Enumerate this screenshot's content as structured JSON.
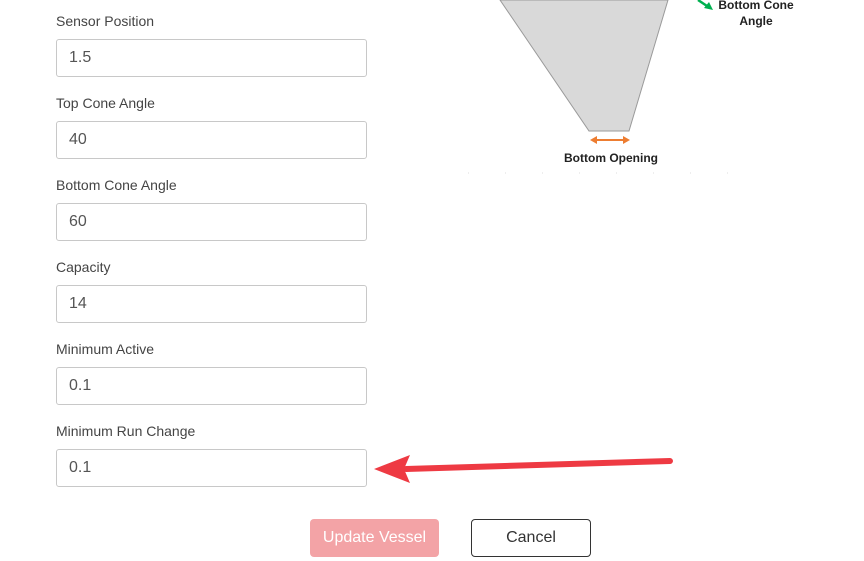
{
  "form": {
    "fields": [
      {
        "label": "Sensor Position",
        "value": "1.5"
      },
      {
        "label": "Top Cone Angle",
        "value": "40"
      },
      {
        "label": "Bottom Cone Angle",
        "value": "60"
      },
      {
        "label": "Capacity",
        "value": "14"
      },
      {
        "label": "Minimum Active",
        "value": "0.1"
      },
      {
        "label": "Minimum Run Change",
        "value": "0.1"
      }
    ]
  },
  "diagram": {
    "bottom_cone_angle_label_line1": "Bottom Cone",
    "bottom_cone_angle_label_line2": "Angle",
    "bottom_opening_label": "Bottom Opening",
    "cone_fill": "#d9d9d9",
    "opening_arrow_color": "#ed7d31",
    "angle_arrow_color": "#00b050"
  },
  "annotation": {
    "arrow_color": "#ee3a43"
  },
  "actions": {
    "update_label": "Update Vessel",
    "cancel_label": "Cancel"
  }
}
